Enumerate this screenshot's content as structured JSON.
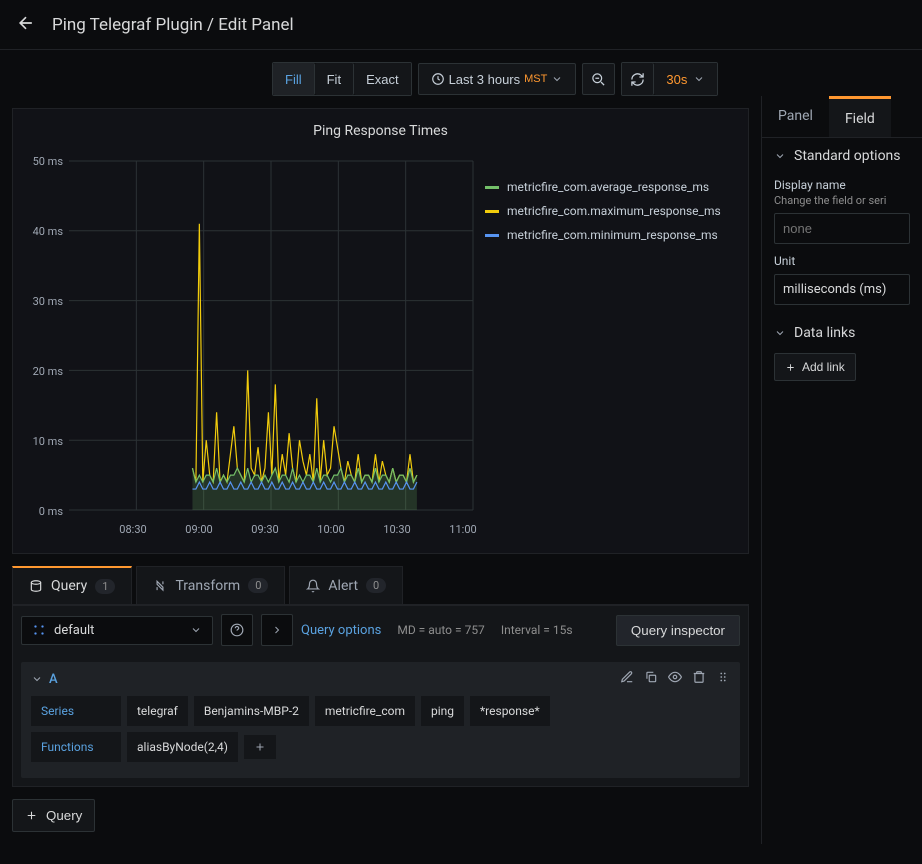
{
  "header": {
    "title": "Ping Telegraf Plugin / Edit Panel"
  },
  "toolbar": {
    "fill": "Fill",
    "fit": "Fit",
    "exact": "Exact",
    "timerange": "Last 3 hours",
    "timezone": "MST",
    "refresh_interval": "30s"
  },
  "chart": {
    "title": "Ping Response Times",
    "legend": [
      {
        "color": "#73bf69",
        "label": "metricfire_com.average_response_ms"
      },
      {
        "color": "#f2cc0c",
        "label": "metricfire_com.maximum_response_ms"
      },
      {
        "color": "#5794f2",
        "label": "metricfire_com.minimum_response_ms"
      }
    ]
  },
  "chart_data": {
    "type": "line",
    "title": "Ping Response Times",
    "xlabel": "",
    "ylabel": "",
    "ylim": [
      0,
      50
    ],
    "y_ticks": [
      "0 ms",
      "10 ms",
      "20 ms",
      "30 ms",
      "40 ms",
      "50 ms"
    ],
    "x_ticks": [
      "08:30",
      "09:00",
      "09:30",
      "10:00",
      "10:30",
      "11:00"
    ],
    "x_range": [
      "08:00",
      "11:00"
    ],
    "series": [
      {
        "name": "metricfire_com.average_response_ms",
        "color": "#73bf69",
        "values": [
          6,
          4,
          5,
          4,
          5,
          5,
          4,
          6,
          4,
          5,
          4,
          5,
          5,
          6,
          5,
          4,
          6,
          4,
          5,
          5,
          4,
          5,
          4,
          5,
          6,
          4,
          5,
          5,
          4,
          6,
          4,
          5,
          4,
          5,
          5,
          4,
          6,
          4,
          5,
          5,
          4,
          5,
          5,
          6,
          4,
          5,
          5,
          4,
          6,
          4,
          5,
          5,
          4,
          6,
          4,
          5,
          5,
          4,
          6,
          4,
          5,
          5,
          4,
          6,
          4,
          5
        ]
      },
      {
        "name": "metricfire_com.maximum_response_ms",
        "color": "#f2cc0c",
        "values": [
          6,
          4,
          41,
          4,
          10,
          5,
          4,
          14,
          4,
          5,
          4,
          8,
          12,
          6,
          5,
          4,
          20,
          6,
          5,
          9,
          4,
          6,
          14,
          5,
          18,
          4,
          8,
          5,
          11,
          6,
          4,
          10,
          7,
          5,
          8,
          4,
          16,
          4,
          10,
          5,
          6,
          12,
          9,
          6,
          4,
          7,
          5,
          4,
          8,
          4,
          5,
          5,
          4,
          8,
          4,
          7,
          5,
          4,
          6,
          4,
          5,
          5,
          4,
          8,
          4,
          5
        ]
      },
      {
        "name": "metricfire_com.minimum_response_ms",
        "color": "#5794f2",
        "values": [
          3,
          3,
          4,
          3,
          3,
          4,
          3,
          3,
          4,
          3,
          3,
          4,
          3,
          3,
          4,
          3,
          3,
          4,
          3,
          3,
          4,
          3,
          3,
          4,
          3,
          3,
          4,
          3,
          3,
          4,
          3,
          3,
          4,
          3,
          3,
          4,
          3,
          3,
          4,
          3,
          3,
          4,
          3,
          3,
          4,
          3,
          3,
          4,
          3,
          3,
          4,
          3,
          3,
          4,
          3,
          3,
          4,
          3,
          3,
          4,
          3,
          3,
          4,
          3,
          3,
          4
        ]
      }
    ]
  },
  "tabs": {
    "query": {
      "label": "Query",
      "count": "1"
    },
    "transform": {
      "label": "Transform",
      "count": "0"
    },
    "alert": {
      "label": "Alert",
      "count": "0"
    }
  },
  "datasource": {
    "selected": "default"
  },
  "query_options": {
    "label": "Query options",
    "md": "MD = auto = 757",
    "interval": "Interval = 15s",
    "inspector": "Query inspector"
  },
  "query_row": {
    "letter": "A",
    "series_label": "Series",
    "series_segments": [
      "telegraf",
      "Benjamins-MBP-2",
      "metricfire_com",
      "ping",
      "*response*"
    ],
    "functions_label": "Functions",
    "functions": [
      "aliasByNode(2,4)"
    ]
  },
  "add_query": "Query",
  "sidebar": {
    "tabs": {
      "panel": "Panel",
      "field": "Field"
    },
    "standard_options": {
      "title": "Standard options",
      "display_name_label": "Display name",
      "display_name_help": "Change the field or seri",
      "display_name_placeholder": "none",
      "unit_label": "Unit",
      "unit_value": "milliseconds (ms)"
    },
    "data_links": {
      "title": "Data links",
      "add_link": "Add link"
    }
  }
}
